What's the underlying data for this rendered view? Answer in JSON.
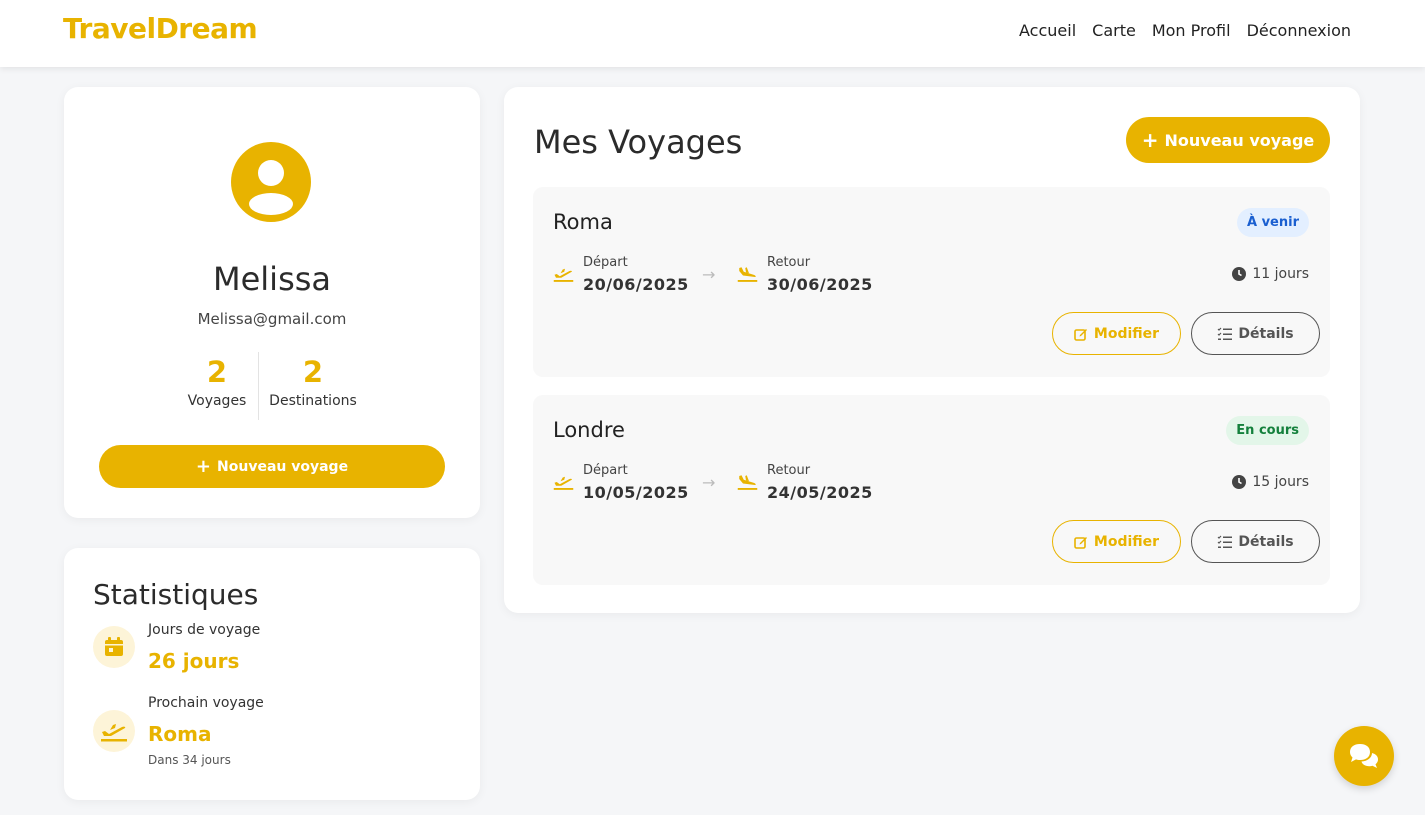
{
  "brand": "TravelDream",
  "nav": [
    "Accueil",
    "Carte",
    "Mon Profil",
    "Déconnexion"
  ],
  "profile": {
    "name": "Melissa",
    "email": "Melissa@gmail.com",
    "stats": [
      {
        "value": "2",
        "label": "Voyages"
      },
      {
        "value": "2",
        "label": "Destinations"
      }
    ],
    "new_trip_label": "Nouveau voyage"
  },
  "statistics": {
    "title": "Statistiques",
    "travel_days": {
      "label": "Jours de voyage",
      "value": "26 jours",
      "icon": "calendar-icon"
    },
    "next_trip": {
      "label": "Prochain voyage",
      "value": "Roma",
      "sub": "Dans 34 jours",
      "icon": "plane-departure-icon"
    }
  },
  "voyages": {
    "title": "Mes Voyages",
    "new_trip_label": "Nouveau voyage",
    "depart_label": "Départ",
    "return_label": "Retour",
    "modify_label": "Modifier",
    "details_label": "Détails",
    "trips": [
      {
        "name": "Roma",
        "status": "À venir",
        "status_color": "#1a5fd0",
        "status_bg": "#e3efff",
        "depart": "20/06/2025",
        "return": "30/06/2025",
        "duration": "11 jours"
      },
      {
        "name": "Londre",
        "status": "En cours",
        "status_color": "#14803c",
        "status_bg": "#e3f6e9",
        "depart": "10/05/2025",
        "return": "24/05/2025",
        "duration": "15 jours"
      }
    ]
  },
  "colors": {
    "accent": "#e8b300",
    "background": "#f5f6f8"
  }
}
